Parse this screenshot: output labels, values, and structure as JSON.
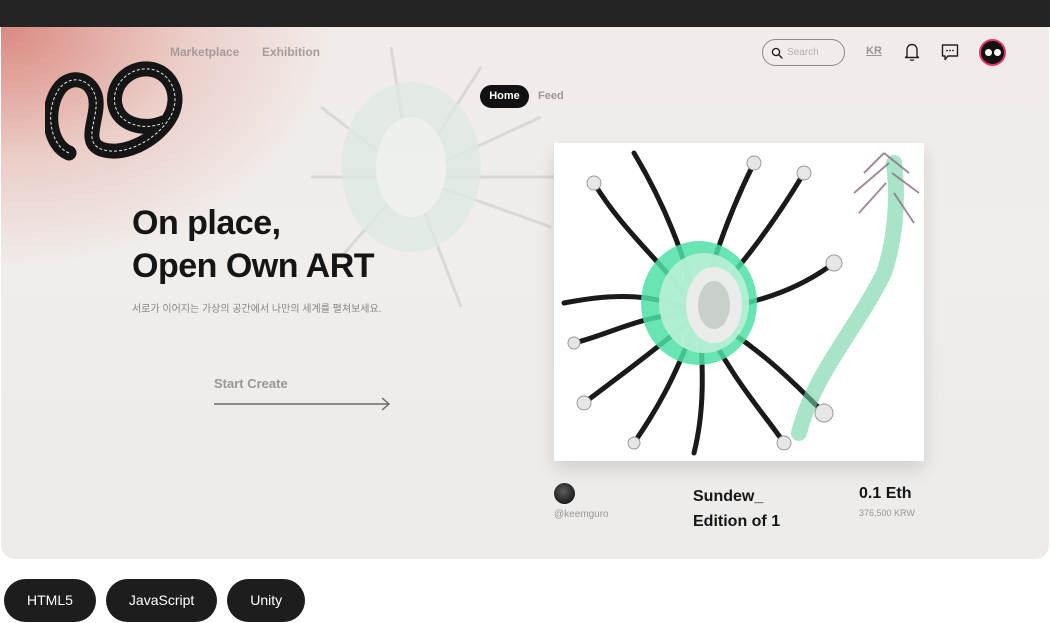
{
  "nav": {
    "marketplace": "Marketplace",
    "exhibition": "Exhibition"
  },
  "logo": {
    "ring_text": "On place, Open Own Art. A virtual space where each other connects. On place, Open Own Art."
  },
  "header": {
    "search_placeholder": "Search",
    "language": "KR",
    "icons": [
      "search-icon",
      "bell-icon",
      "chat-icon",
      "profile-avatar"
    ]
  },
  "tabs": {
    "home": "Home",
    "feed": "Feed",
    "active": "Home"
  },
  "hero": {
    "headline_line1": "On place,",
    "headline_line2": "Open Own ART",
    "subtitle": "서로가 이어지는 가상의 공간에서 나만의 세계를 펼쳐보세요.",
    "cta": "Start Create"
  },
  "artwork": {
    "creator": "@keemguro",
    "title_line1": "Sundew_",
    "title_line2": "Edition of 1",
    "price": "0.1 Eth",
    "price_krw": "376,500 KRW"
  },
  "tags": [
    "HTML5",
    "JavaScript",
    "Unity"
  ],
  "colors": {
    "accent_dark": "#111111",
    "gradient_pink": "#d6786e",
    "text_muted": "#9b9694"
  }
}
